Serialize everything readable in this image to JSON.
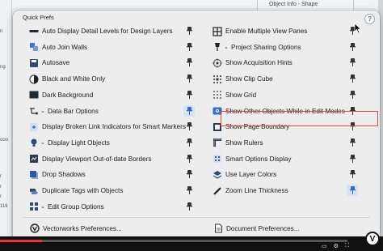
{
  "background": {
    "tab_title": "Object Info - Shape",
    "left_fragments": [
      "n",
      "ng",
      "ooo",
      "r",
      "r",
      "r",
      "116"
    ]
  },
  "popover": {
    "title": "Quick Prefs",
    "help_label": "?",
    "left_column": [
      {
        "label": "Auto Display Detail Levels for Design Layers",
        "icon": "detail-levels-icon",
        "has_chevron": false,
        "pinned": true,
        "pin_active": false
      },
      {
        "label": "Auto Join Walls",
        "icon": "join-walls-icon",
        "has_chevron": false,
        "pinned": true,
        "pin_active": false
      },
      {
        "label": "Autosave",
        "icon": "autosave-icon",
        "has_chevron": false,
        "pinned": true,
        "pin_active": false
      },
      {
        "label": "Black and White Only",
        "icon": "black-white-icon",
        "has_chevron": false,
        "pinned": true,
        "pin_active": false
      },
      {
        "label": "Dark Background",
        "icon": "dark-background-icon",
        "has_chevron": false,
        "pinned": true,
        "pin_active": false
      },
      {
        "label": "Data Bar Options",
        "icon": "data-bar-icon",
        "has_chevron": true,
        "pinned": true,
        "pin_active": true
      },
      {
        "label": "Display Broken Link Indicators for Smart Markers",
        "icon": "broken-link-icon",
        "has_chevron": false,
        "pinned": true,
        "pin_active": false
      },
      {
        "label": "Display Light Objects",
        "icon": "light-objects-icon",
        "has_chevron": true,
        "pinned": true,
        "pin_active": false
      },
      {
        "label": "Display Viewport Out-of-date Borders",
        "icon": "viewport-borders-icon",
        "has_chevron": false,
        "pinned": true,
        "pin_active": false
      },
      {
        "label": "Drop Shadows",
        "icon": "drop-shadows-icon",
        "has_chevron": false,
        "pinned": true,
        "pin_active": false
      },
      {
        "label": "Duplicate Tags with Objects",
        "icon": "duplicate-tags-icon",
        "has_chevron": false,
        "pinned": true,
        "pin_active": false
      },
      {
        "label": "Edit Group Options",
        "icon": "edit-group-icon",
        "has_chevron": true,
        "pinned": true,
        "pin_active": false
      }
    ],
    "right_column": [
      {
        "label": "Enable Multiple View Panes",
        "icon": "view-panes-icon",
        "has_chevron": false,
        "pinned": true,
        "pin_active": false
      },
      {
        "label": "Project Sharing Options",
        "icon": "project-sharing-icon",
        "has_chevron": true,
        "pinned": true,
        "pin_active": false
      },
      {
        "label": "Show Acquisition Hints",
        "icon": "acquisition-hints-icon",
        "has_chevron": false,
        "pinned": true,
        "pin_active": false
      },
      {
        "label": "Show Clip Cube",
        "icon": "clip-cube-icon",
        "has_chevron": false,
        "pinned": true,
        "pin_active": false
      },
      {
        "label": "Show Grid",
        "icon": "grid-icon",
        "has_chevron": false,
        "pinned": true,
        "pin_active": false
      },
      {
        "label": "Show Other Objects While in Edit Modes",
        "icon": "other-objects-icon",
        "has_chevron": false,
        "pinned": true,
        "pin_active": false,
        "highlighted": true
      },
      {
        "label": "Show Page Boundary",
        "icon": "page-boundary-icon",
        "has_chevron": false,
        "pinned": true,
        "pin_active": false
      },
      {
        "label": "Show Rulers",
        "icon": "rulers-icon",
        "has_chevron": false,
        "pinned": true,
        "pin_active": false
      },
      {
        "label": "Smart Options Display",
        "icon": "smart-options-icon",
        "has_chevron": false,
        "pinned": true,
        "pin_active": false
      },
      {
        "label": "Use Layer Colors",
        "icon": "layer-colors-icon",
        "has_chevron": false,
        "pinned": true,
        "pin_active": false
      },
      {
        "label": "Zoom Line Thickness",
        "icon": "zoom-line-icon",
        "has_chevron": false,
        "pinned": true,
        "pin_active": true
      }
    ],
    "footer": {
      "left_label": "Vectorworks Preferences...",
      "right_label": "Document Preferences..."
    }
  },
  "video": {
    "progress_fraction": 0.12,
    "logo": "V"
  },
  "colors": {
    "accent": "#2d4a73",
    "pin_active_bg": "#d5e3f6",
    "highlight_border": "#e04a3a",
    "progress": "#e33333"
  }
}
